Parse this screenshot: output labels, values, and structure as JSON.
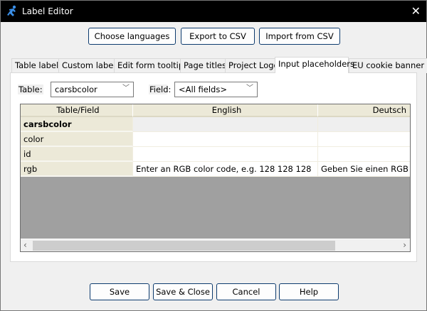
{
  "window": {
    "title": "Label Editor",
    "icon": "running-man-icon"
  },
  "toolbar": {
    "choose_languages": "Choose languages",
    "export_csv": "Export to CSV",
    "import_csv": "Import from CSV"
  },
  "tabs": [
    {
      "label": "Table labels",
      "active": false
    },
    {
      "label": "Custom labels",
      "active": false
    },
    {
      "label": "Edit form tooltips",
      "active": false
    },
    {
      "label": "Page titles",
      "active": false
    },
    {
      "label": "Project Logo",
      "active": false
    },
    {
      "label": "Input placeholders",
      "active": true
    },
    {
      "label": "EU cookie banner",
      "active": false
    }
  ],
  "filters": {
    "table_label": "Table:",
    "table_value": "carsbcolor",
    "field_label": "Field:",
    "field_value": "<All fields>"
  },
  "grid": {
    "columns": [
      "Table/Field",
      "English",
      "Deutsch"
    ],
    "rows": [
      {
        "name": "carsbcolor",
        "english": "",
        "deutsch": "",
        "is_table": true
      },
      {
        "name": "color",
        "english": "",
        "deutsch": ""
      },
      {
        "name": "id",
        "english": "",
        "deutsch": ""
      },
      {
        "name": "rgb",
        "english": "Enter an RGB color code, e.g. 128 128 128",
        "deutsch": "Geben Sie einen RGB"
      }
    ]
  },
  "footer": {
    "save": "Save",
    "save_close": "Save & Close",
    "cancel": "Cancel",
    "help": "Help"
  }
}
